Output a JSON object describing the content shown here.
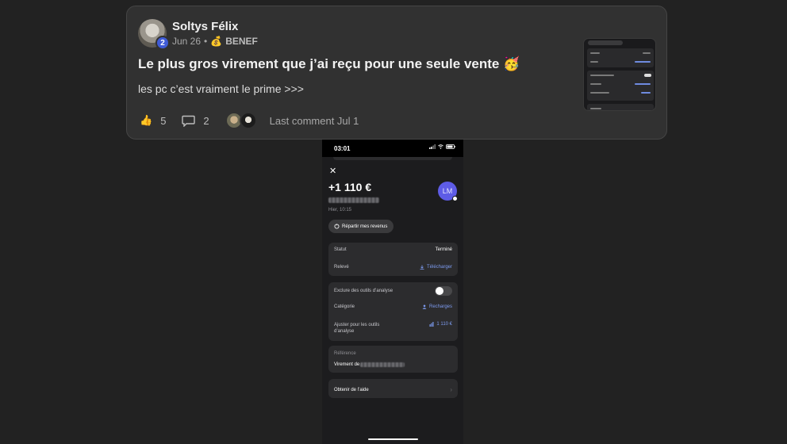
{
  "post": {
    "author": "Soltys Félix",
    "avatar_badge": "2",
    "date": "Jun 26",
    "separator": "•",
    "tag_icon": "money-bag-icon",
    "tag": "BENEF",
    "title": "Le plus gros virement que j’ai reçu pour une seule vente 🥳",
    "body": "les pc c’est vraiment le prime >>>",
    "likes": "5",
    "comments": "2",
    "last_comment": "Last comment Jul 1"
  },
  "phone": {
    "time": "03:01",
    "close": "✕",
    "amount": "+1 110 €",
    "date": "Hier, 10:15",
    "avatar_initials": "LM",
    "split_button": "Répartir mes revenus",
    "status_label": "Statut",
    "status_value": "Terminé",
    "statement_label": "Relevé",
    "statement_action": "Télécharger",
    "exclude_label": "Exclure des outils d’analyse",
    "category_label": "Catégorie",
    "category_value": "Recharges",
    "adjust_label": "Ajuster pour les outils d’analyse",
    "adjust_value": "1 110 €",
    "reference_label": "Référence",
    "reference_prefix": "Virement de",
    "help_label": "Obtenir de l’aide",
    "help_chevron": "›"
  },
  "colors": {
    "background": "#222222",
    "card": "#313131",
    "badge": "#3f5bd6",
    "link_blue": "#7d9bf0",
    "avatar_purple": "#5e5ce6"
  }
}
